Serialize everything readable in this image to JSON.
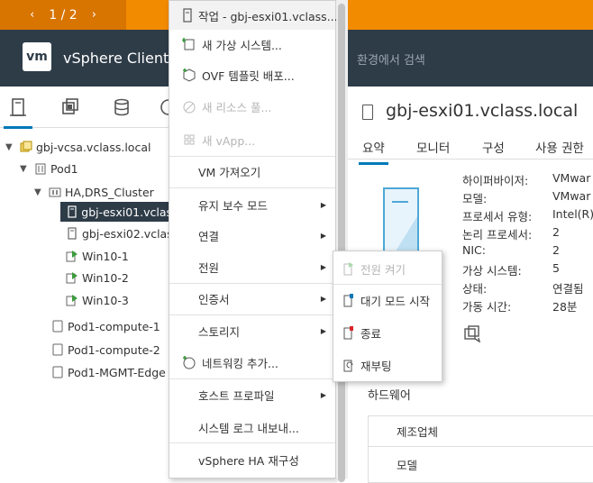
{
  "pager": {
    "text": "1 / 2",
    "prev": "‹",
    "next": "›"
  },
  "header": {
    "logo": "vm",
    "title": "vSphere Client",
    "search_suffix": "환경에서 검색"
  },
  "tree": [
    {
      "label": "gbj-vcsa.vclass.local"
    },
    {
      "label": "Pod1"
    },
    {
      "label": "HA,DRS_Cluster"
    },
    {
      "label": "gbj-esxi01.vclas"
    },
    {
      "label": "gbj-esxi02.vclas"
    },
    {
      "label": "Win10-1"
    },
    {
      "label": "Win10-2"
    },
    {
      "label": "Win10-3"
    },
    {
      "label": "Pod1-compute-1"
    },
    {
      "label": "Pod1-compute-2"
    },
    {
      "label": "Pod1-MGMT-Edge"
    }
  ],
  "context_menu": {
    "items": [
      {
        "label": "작업 - gbj-esxi01.vclass..."
      },
      {
        "label": "새 가상 시스템..."
      },
      {
        "label": "OVF 템플릿 배포..."
      },
      {
        "label": "새 리소스 풀..."
      },
      {
        "label": "새 vApp..."
      },
      {
        "label": "VM 가져오기"
      },
      {
        "label": "유지 보수 모드"
      },
      {
        "label": "연결"
      },
      {
        "label": "전원"
      },
      {
        "label": "인증서"
      },
      {
        "label": "스토리지"
      },
      {
        "label": "네트워킹 추가..."
      },
      {
        "label": "호스트 프로파일"
      },
      {
        "label": "시스템 로그 내보내..."
      },
      {
        "label": "vSphere HA 재구성"
      }
    ]
  },
  "power_submenu": {
    "items": [
      {
        "label": "전원 켜기"
      },
      {
        "label": "대기 모드 시작"
      },
      {
        "label": "종료"
      },
      {
        "label": "재부팅"
      }
    ]
  },
  "host": {
    "title": "gbj-esxi01.vclass.local",
    "tabs": [
      "요약",
      "모니터",
      "구성",
      "사용 권한"
    ],
    "summary": [
      {
        "key": "하이퍼바이저:",
        "value": "VMwar"
      },
      {
        "key": "모델:",
        "value": "VMwar"
      },
      {
        "key": "프로세서 유형:",
        "value": "Intel(R)"
      },
      {
        "key": "논리 프로세서:",
        "value": "2"
      },
      {
        "key": "NIC:",
        "value": "2"
      },
      {
        "key": "가상 시스템:",
        "value": "5"
      },
      {
        "key": "상태:",
        "value": "연결됨"
      },
      {
        "key": "가동 시간:",
        "value": "28분"
      }
    ],
    "hardware_title": "하드웨어",
    "hardware_rows": [
      "제조업체",
      "모델"
    ]
  },
  "colors": {
    "accent": "#0079b8",
    "header_bg": "#2e3c48",
    "topbar": "#f38b00"
  }
}
